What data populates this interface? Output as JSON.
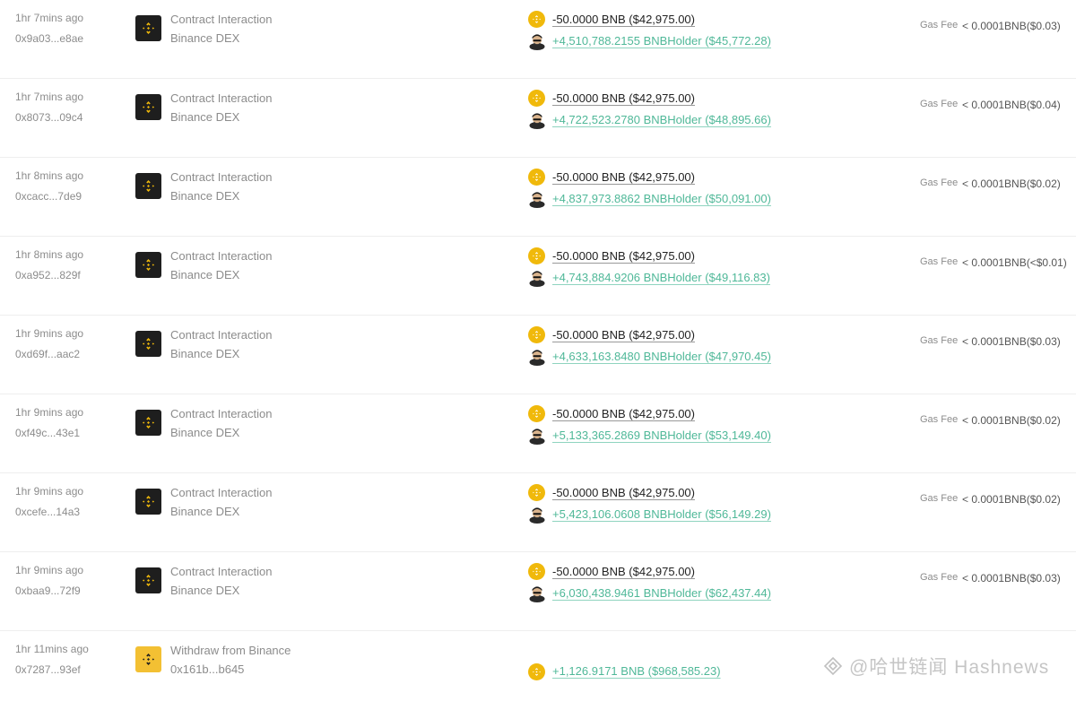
{
  "transactions": [
    {
      "time": "1hr 7mins ago",
      "hash": "0x9a03...e8ae",
      "type": "Contract Interaction",
      "sub": "Binance DEX",
      "out": "-50.0000 BNB ($42,975.00)",
      "in": "+4,510,788.2155 BNBHolder ($45,772.28)",
      "gas_label": "Gas Fee",
      "gas_value": "< 0.0001BNB($0.03)"
    },
    {
      "time": "1hr 7mins ago",
      "hash": "0x8073...09c4",
      "type": "Contract Interaction",
      "sub": "Binance DEX",
      "out": "-50.0000 BNB ($42,975.00)",
      "in": "+4,722,523.2780 BNBHolder ($48,895.66)",
      "gas_label": "Gas Fee",
      "gas_value": "< 0.0001BNB($0.04)"
    },
    {
      "time": "1hr 8mins ago",
      "hash": "0xcacc...7de9",
      "type": "Contract Interaction",
      "sub": "Binance DEX",
      "out": "-50.0000 BNB ($42,975.00)",
      "in": "+4,837,973.8862 BNBHolder ($50,091.00)",
      "gas_label": "Gas Fee",
      "gas_value": "< 0.0001BNB($0.02)"
    },
    {
      "time": "1hr 8mins ago",
      "hash": "0xa952...829f",
      "type": "Contract Interaction",
      "sub": "Binance DEX",
      "out": "-50.0000 BNB ($42,975.00)",
      "in": "+4,743,884.9206 BNBHolder ($49,116.83)",
      "gas_label": "Gas Fee",
      "gas_value": "< 0.0001BNB(<$0.01)"
    },
    {
      "time": "1hr 9mins ago",
      "hash": "0xd69f...aac2",
      "type": "Contract Interaction",
      "sub": "Binance DEX",
      "out": "-50.0000 BNB ($42,975.00)",
      "in": "+4,633,163.8480 BNBHolder ($47,970.45)",
      "gas_label": "Gas Fee",
      "gas_value": "< 0.0001BNB($0.03)"
    },
    {
      "time": "1hr 9mins ago",
      "hash": "0xf49c...43e1",
      "type": "Contract Interaction",
      "sub": "Binance DEX",
      "out": "-50.0000 BNB ($42,975.00)",
      "in": "+5,133,365.2869 BNBHolder ($53,149.40)",
      "gas_label": "Gas Fee",
      "gas_value": "< 0.0001BNB($0.02)"
    },
    {
      "time": "1hr 9mins ago",
      "hash": "0xcefe...14a3",
      "type": "Contract Interaction",
      "sub": "Binance DEX",
      "out": "-50.0000 BNB ($42,975.00)",
      "in": "+5,423,106.0608 BNBHolder ($56,149.29)",
      "gas_label": "Gas Fee",
      "gas_value": "< 0.0001BNB($0.02)"
    },
    {
      "time": "1hr 9mins ago",
      "hash": "0xbaa9...72f9",
      "type": "Contract Interaction",
      "sub": "Binance DEX",
      "out": "-50.0000 BNB ($42,975.00)",
      "in": "+6,030,438.9461 BNBHolder ($62,437.44)",
      "gas_label": "Gas Fee",
      "gas_value": "< 0.0001BNB($0.03)"
    },
    {
      "time": "1hr 11mins ago",
      "hash": "0x7287...93ef",
      "type": "Withdraw from Binance",
      "sub": "0x161b...b645",
      "in": "+1,126.9171 BNB ($968,585.23)"
    }
  ],
  "watermark": {
    "text": "@哈世链闻 Hashnews"
  },
  "colors": {
    "bnb_gold": "#f0b90b",
    "positive_green": "#4fb898",
    "logo_dark": "#1e1e1e"
  }
}
